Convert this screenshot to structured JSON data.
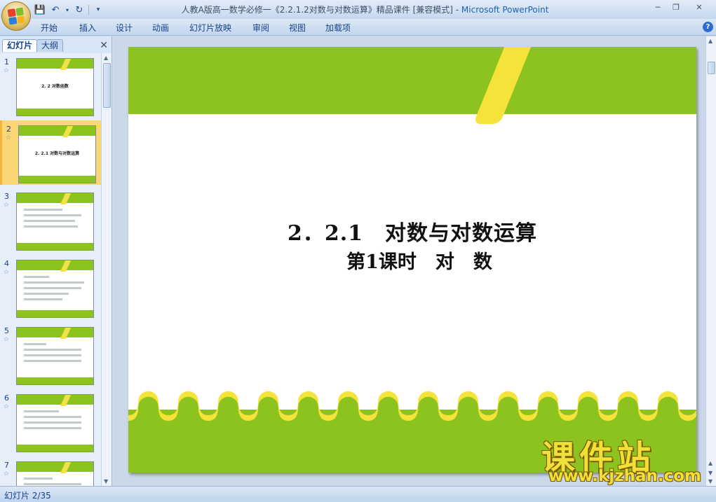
{
  "window": {
    "title_doc": "人教A版高一数学必修一《2.2.1.2对数与对数运算》精品课件 [兼容模式]",
    "title_sep": " - ",
    "title_app": "Microsoft PowerPoint"
  },
  "ribbon": {
    "tabs": [
      "开始",
      "插入",
      "设计",
      "动画",
      "幻灯片放映",
      "审阅",
      "视图",
      "加载项"
    ],
    "help": "?"
  },
  "pane": {
    "tab_slides": "幻灯片",
    "tab_outline": "大纲",
    "thumbnails": [
      {
        "num": "1",
        "title": "2. 2 对数函数"
      },
      {
        "num": "2",
        "title": "2. 2.1 对数与对数运算"
      },
      {
        "num": "3",
        "title": ""
      },
      {
        "num": "4",
        "title": ""
      },
      {
        "num": "5",
        "title": ""
      },
      {
        "num": "6",
        "title": ""
      },
      {
        "num": "7",
        "title": ""
      }
    ],
    "selected": 2
  },
  "slide": {
    "title_line1": "2．2.1　对数与对数运算",
    "title_line2": "第1课时　对　数"
  },
  "watermark": {
    "line1": "课件站",
    "line2": "www.kjzhan.com"
  },
  "status": {
    "slide_indicator": "幻灯片 2/35"
  },
  "colors": {
    "slide_green": "#8cc31e",
    "slide_yellow": "#f5e33a",
    "selected_thumb": "#fbd675"
  }
}
